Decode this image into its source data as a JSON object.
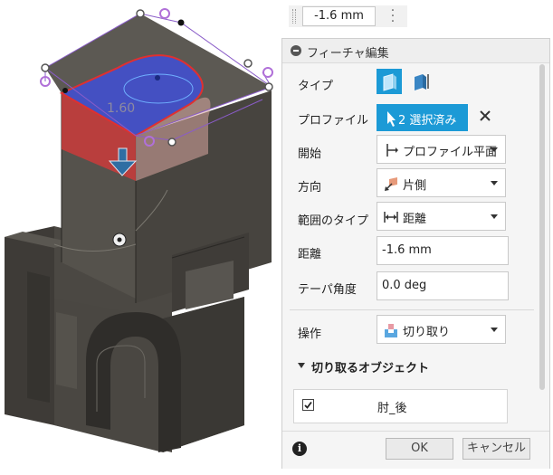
{
  "toolbar": {
    "distance_value": "-1.6 mm"
  },
  "viewport": {
    "dimension_label": "1.60"
  },
  "panel": {
    "title": "フィーチャ編集",
    "rows": {
      "type_label": "タイプ",
      "profile_label": "プロファイル",
      "profile_value": "2 選択済み",
      "start_label": "開始",
      "start_value": "プロファイル平面",
      "direction_label": "方向",
      "direction_value": "片側",
      "extent_label": "範囲のタイプ",
      "extent_value": "距離",
      "distance_label": "距離",
      "distance_value": "-1.6 mm",
      "taper_label": "テーパ角度",
      "taper_value": "0.0 deg",
      "operation_label": "操作",
      "operation_value": "切り取り"
    },
    "objects_section": {
      "title": "切り取るオブジェクト",
      "items": [
        {
          "name": "肘_後",
          "checked": true
        }
      ]
    },
    "buttons": {
      "ok": "OK",
      "cancel": "キャンセル"
    }
  },
  "colors": {
    "accent": "#1c9ad6",
    "model_body": "#4a4742",
    "selection_blue": "#3f4fd6",
    "selection_red": "#d23a3a",
    "manipulator_arrow": "#2f6ea3"
  }
}
